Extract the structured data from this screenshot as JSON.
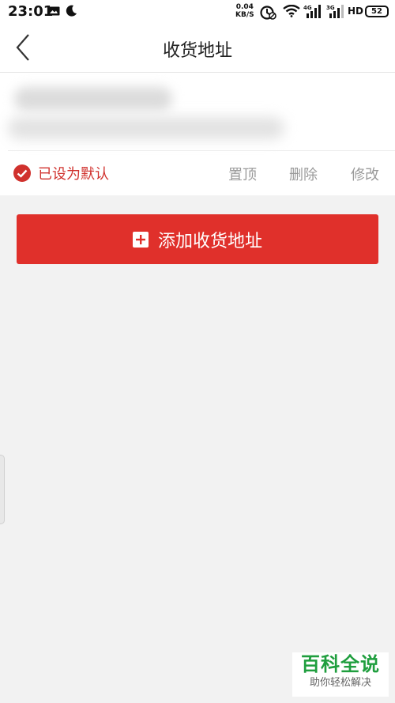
{
  "status_bar": {
    "time": "23:01",
    "net_speed_value": "0.04",
    "net_speed_unit": "KB/S",
    "hd": "HD",
    "battery": "52",
    "icons": [
      "mail-icon",
      "moon-icon",
      "alarm-icon",
      "wifi-icon",
      "signal-4g-icon",
      "signal-3g-icon",
      "battery-icon"
    ]
  },
  "header": {
    "title": "收货地址"
  },
  "address": {
    "default_label": "已设为默认",
    "actions": {
      "pin": "置顶",
      "delete": "删除",
      "edit": "修改"
    }
  },
  "add_button": {
    "label": "添加收货地址"
  },
  "watermark": {
    "main": "百科全说",
    "sub": "助你轻松解决"
  },
  "colors": {
    "accent": "#e0302b",
    "background": "#f2f2f2",
    "watermark_green": "#1f9e3e"
  }
}
